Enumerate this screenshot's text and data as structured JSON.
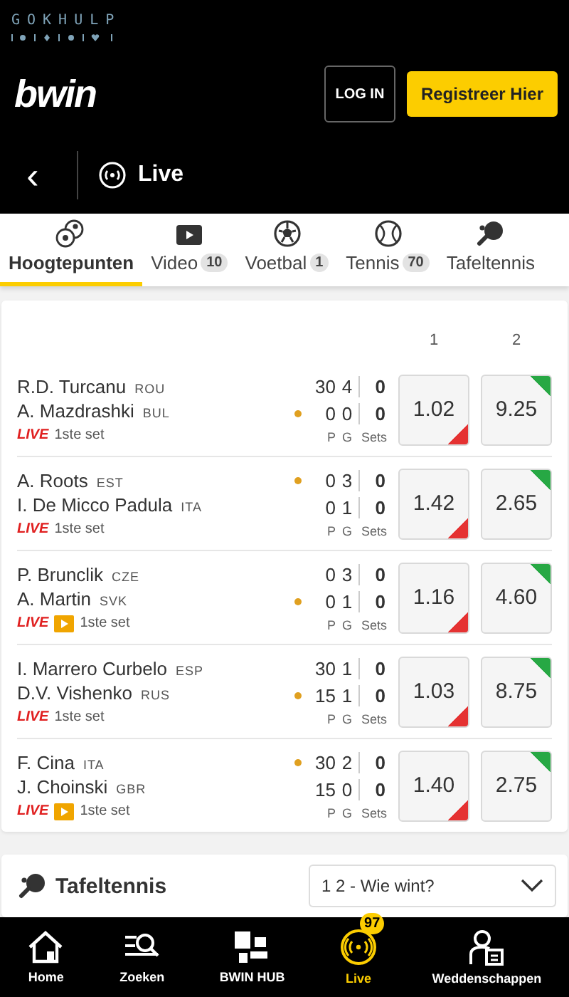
{
  "help_logo": {
    "text": "GOKHULP"
  },
  "header": {
    "logo": "bwin",
    "login": "LOG IN",
    "register": "Registreer Hier"
  },
  "live_bar": {
    "back": "‹",
    "title": "Live"
  },
  "tabs": [
    {
      "kind": "highlights",
      "label": "Hoogtepunten",
      "selected": true
    },
    {
      "kind": "video",
      "label": "Video",
      "count": "10",
      "selected": false
    },
    {
      "kind": "football",
      "label": "Voetbal",
      "count": "1",
      "selected": false
    },
    {
      "kind": "tennis",
      "label": "Tennis",
      "count": "70",
      "selected": false
    },
    {
      "kind": "tabletennis",
      "label": "Tafeltennis",
      "selected": false
    }
  ],
  "odds_columns": [
    "1",
    "2"
  ],
  "matches": [
    {
      "p1": "R.D. Turcanu",
      "c1": "ROU",
      "p2": "A. Mazdrashki",
      "c2": "BUL",
      "serving": [
        false,
        true
      ],
      "pts": [
        "30",
        "0"
      ],
      "games": [
        "4",
        "0"
      ],
      "sets": [
        "0",
        "0"
      ],
      "live": "LIVE",
      "video": false,
      "status": "1ste set",
      "labels": [
        "P",
        "G",
        "Sets"
      ],
      "odds": [
        {
          "value": "1.02",
          "rising": false
        },
        {
          "value": "9.25",
          "rising": true
        }
      ]
    },
    {
      "p1": "A. Roots",
      "c1": "EST",
      "p2": "I. De Micco Padula",
      "c2": "ITA",
      "serving": [
        true,
        false
      ],
      "pts": [
        "0",
        "0"
      ],
      "games": [
        "3",
        "1"
      ],
      "sets": [
        "0",
        "0"
      ],
      "live": "LIVE",
      "video": false,
      "status": "1ste set",
      "labels": [
        "P",
        "G",
        "Sets"
      ],
      "odds": [
        {
          "value": "1.42",
          "rising": false
        },
        {
          "value": "2.65",
          "rising": true
        }
      ]
    },
    {
      "p1": "P. Brunclik",
      "c1": "CZE",
      "p2": "A. Martin",
      "c2": "SVK",
      "serving": [
        false,
        true
      ],
      "pts": [
        "0",
        "0"
      ],
      "games": [
        "3",
        "1"
      ],
      "sets": [
        "0",
        "0"
      ],
      "live": "LIVE",
      "video": true,
      "status": "1ste set",
      "labels": [
        "P",
        "G",
        "Sets"
      ],
      "odds": [
        {
          "value": "1.16",
          "rising": false
        },
        {
          "value": "4.60",
          "rising": true
        }
      ]
    },
    {
      "p1": "I. Marrero Curbelo",
      "c1": "ESP",
      "p2": "D.V. Vishenko",
      "c2": "RUS",
      "serving": [
        false,
        true
      ],
      "pts": [
        "30",
        "15"
      ],
      "games": [
        "1",
        "1"
      ],
      "sets": [
        "0",
        "0"
      ],
      "live": "LIVE",
      "video": false,
      "status": "1ste set",
      "labels": [
        "P",
        "G",
        "Sets"
      ],
      "odds": [
        {
          "value": "1.03",
          "rising": false
        },
        {
          "value": "8.75",
          "rising": true
        }
      ]
    },
    {
      "p1": "F. Cina",
      "c1": "ITA",
      "p2": "J. Choinski",
      "c2": "GBR",
      "serving": [
        true,
        false
      ],
      "pts": [
        "30",
        "15"
      ],
      "games": [
        "2",
        "0"
      ],
      "sets": [
        "0",
        "0"
      ],
      "live": "LIVE",
      "video": true,
      "status": "1ste set",
      "labels": [
        "P",
        "G",
        "Sets"
      ],
      "odds": [
        {
          "value": "1.40",
          "rising": false
        },
        {
          "value": "2.75",
          "rising": true
        }
      ]
    }
  ],
  "section": {
    "title": "Tafeltennis",
    "market": "1 2 - Wie wint?"
  },
  "bottom_nav": [
    {
      "kind": "home",
      "label": "Home",
      "selected": false
    },
    {
      "kind": "search",
      "label": "Zoeken",
      "selected": false
    },
    {
      "kind": "hub",
      "label": "BWIN HUB",
      "selected": false
    },
    {
      "kind": "live",
      "label": "Live",
      "badge": "97",
      "selected": true
    },
    {
      "kind": "bets",
      "label": "Weddenschappen",
      "selected": false
    }
  ]
}
